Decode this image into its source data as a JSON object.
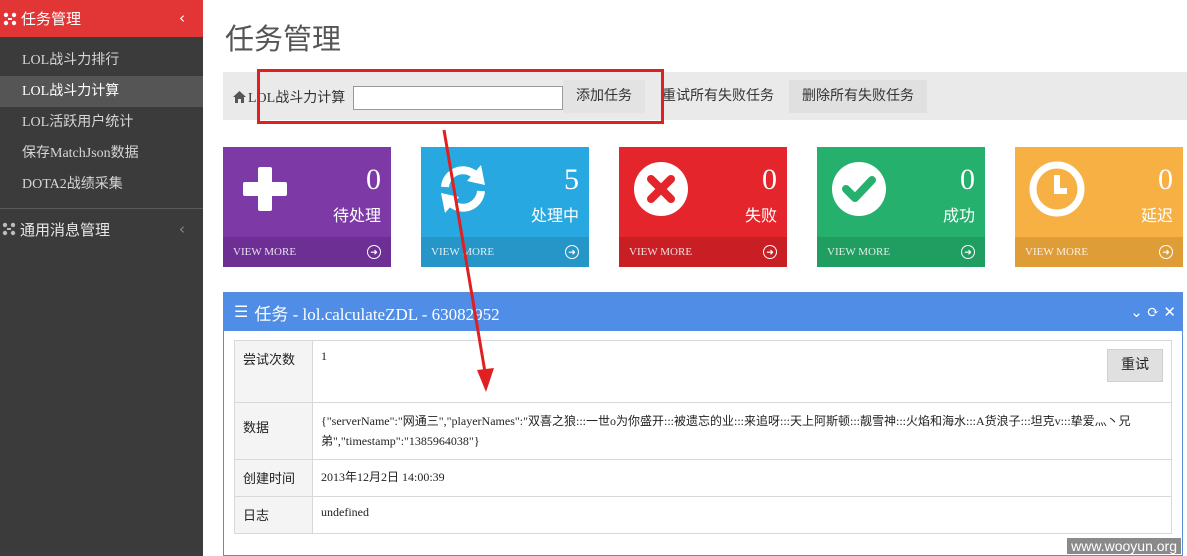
{
  "sidebar": {
    "header_label": "任务管理",
    "items": [
      {
        "label": "LOL战斗力排行"
      },
      {
        "label": "LOL战斗力计算"
      },
      {
        "label": "LOL活跃用户统计"
      },
      {
        "label": "保存MatchJson数据"
      },
      {
        "label": "DOTA2战绩采集"
      }
    ],
    "active_index": 1,
    "group_label": "通用消息管理"
  },
  "page_title": "任务管理",
  "toolbar": {
    "label": "LOL战斗力计算",
    "input_value": "",
    "add_label": "添加任务",
    "retry_all_label": "重试所有失败任务",
    "delete_all_label": "删除所有失败任务"
  },
  "stats": [
    {
      "count": "0",
      "label": "待处理",
      "footer": "VIEW MORE",
      "icon": "plus-icon",
      "color": "#7d3aa6"
    },
    {
      "count": "5",
      "label": "处理中",
      "footer": "VIEW MORE",
      "icon": "refresh-icon",
      "color": "#27a8e0"
    },
    {
      "count": "0",
      "label": "失败",
      "footer": "VIEW MORE",
      "icon": "x-circle-icon",
      "color": "#e5252c"
    },
    {
      "count": "0",
      "label": "成功",
      "footer": "VIEW MORE",
      "icon": "check-circle-icon",
      "color": "#26b06e"
    },
    {
      "count": "0",
      "label": "延迟",
      "footer": "VIEW MORE",
      "icon": "clock-icon",
      "color": "#f7b044"
    }
  ],
  "task": {
    "title": "任务 - lol.calculateZDL - 63082952",
    "rows": [
      {
        "key": "尝试次数",
        "value": "1"
      },
      {
        "key": "数据",
        "value": "{\"serverName\":\"网通三\",\"playerNames\":\"双喜之狼:::一世o为你盛开:::被遗忘的业:::来追呀:::天上阿斯顿:::靓雪神:::火焰和海水:::A货浪子:::坦克v:::挚爱灬丶兄弟\",\"timestamp\":\"1385964038\"}"
      },
      {
        "key": "创建时间",
        "value": "2013年12月2日 14:00:39"
      },
      {
        "key": "日志",
        "value": "undefined"
      }
    ],
    "retry_label": "重试"
  },
  "watermark": "www.wooyun.org"
}
